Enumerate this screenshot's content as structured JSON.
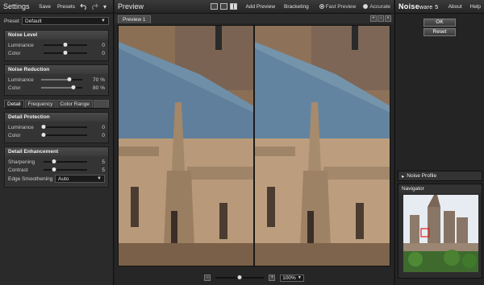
{
  "settings": {
    "title": "Settings",
    "save_label": "Save",
    "presets_label": "Presets",
    "undo_icon": "undo-icon",
    "redo_icon": "redo-icon",
    "menu_icon": "chevron-down-icon",
    "preset_label": "Preset",
    "preset_value": "Default"
  },
  "noise_level": {
    "title": "Noise Level",
    "rows": [
      {
        "label": "Luminance",
        "value": "0",
        "fraction": 0.5
      },
      {
        "label": "Color",
        "value": "0",
        "fraction": 0.5
      }
    ]
  },
  "noise_reduction": {
    "title": "Noise Reduction",
    "rows": [
      {
        "label": "Luminance",
        "value": "70",
        "unit": "%",
        "fraction": 0.7
      },
      {
        "label": "Color",
        "value": "80",
        "unit": "%",
        "fraction": 0.8
      }
    ]
  },
  "tabs": [
    "Detail",
    "Frequency",
    "Color Range"
  ],
  "detail_protection": {
    "title": "Detail Protection",
    "rows": [
      {
        "label": "Luminance",
        "value": "0",
        "fraction": 0.0
      },
      {
        "label": "Color",
        "value": "0",
        "fraction": 0.0
      }
    ]
  },
  "detail_enhancement": {
    "title": "Detail Enhancement",
    "rows": [
      {
        "label": "Sharpening",
        "value": "5",
        "fraction": 0.25
      },
      {
        "label": "Contrast",
        "value": "5",
        "fraction": 0.25
      }
    ],
    "edge_label": "Edge Smoothening",
    "edge_value": "Auto"
  },
  "preview": {
    "title": "Preview",
    "add_preview": "Add Preview",
    "bracketing": "Bracketing",
    "fast_preview": "Fast Preview",
    "accurate": "Accurate",
    "selected_mode": "Fast Preview",
    "tab": "Preview 1",
    "zoom": "100%",
    "zoom_fraction": 0.5
  },
  "right": {
    "brand_main": "Noise",
    "brand_sub": "ware",
    "brand_ver": "5",
    "about": "About",
    "help": "Help",
    "ok": "OK",
    "reset": "Reset",
    "noise_profile": "Noise Profile",
    "navigator": "Navigator"
  },
  "colors": {
    "panel_bg": "#2a2a2a",
    "group_bg": "#343434",
    "roof_blue": "#5f7f9c",
    "stone": "#b89a7a"
  }
}
